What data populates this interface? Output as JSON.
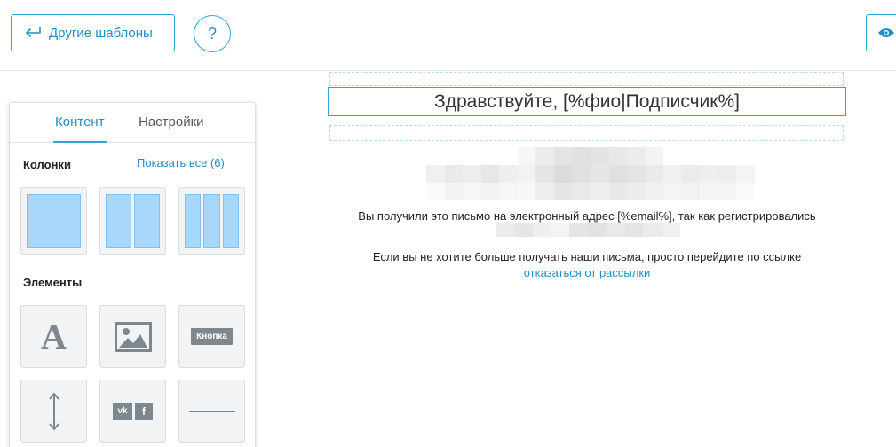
{
  "toolbar": {
    "back_label": "Другие шаблоны",
    "help_label": "?",
    "preview_icon": "eye-icon"
  },
  "panel": {
    "tabs": [
      {
        "label": "Контент",
        "active": true
      },
      {
        "label": "Настройки",
        "active": false
      }
    ],
    "columns_heading": "Колонки",
    "show_all_label": "Показать все (6)",
    "column_layouts": [
      1,
      2,
      3
    ],
    "elements_heading": "Элементы",
    "elements": [
      {
        "icon": "text-icon",
        "glyph": "A"
      },
      {
        "icon": "image-icon"
      },
      {
        "icon": "button-icon",
        "label": "Кнопка"
      },
      {
        "icon": "spacer-icon"
      },
      {
        "icon": "social-icon",
        "vk": "vk",
        "fb": "f"
      },
      {
        "icon": "divider-icon"
      }
    ]
  },
  "canvas": {
    "greeting": "Здравствуйте, [%фио|Подписчик%]",
    "line1": "Вы получили это письмо на электронный адрес [%email%], так как регистрировались",
    "line2": "Если вы не хотите больше получать наши письма, просто перейдите по ссылке",
    "unsubscribe": "отказаться от рассылки"
  },
  "colors": {
    "accent": "#2fa4d7",
    "link": "#1e90c8",
    "column_fill": "#a7d7fb",
    "tile_bg": "#f1f3f5"
  }
}
